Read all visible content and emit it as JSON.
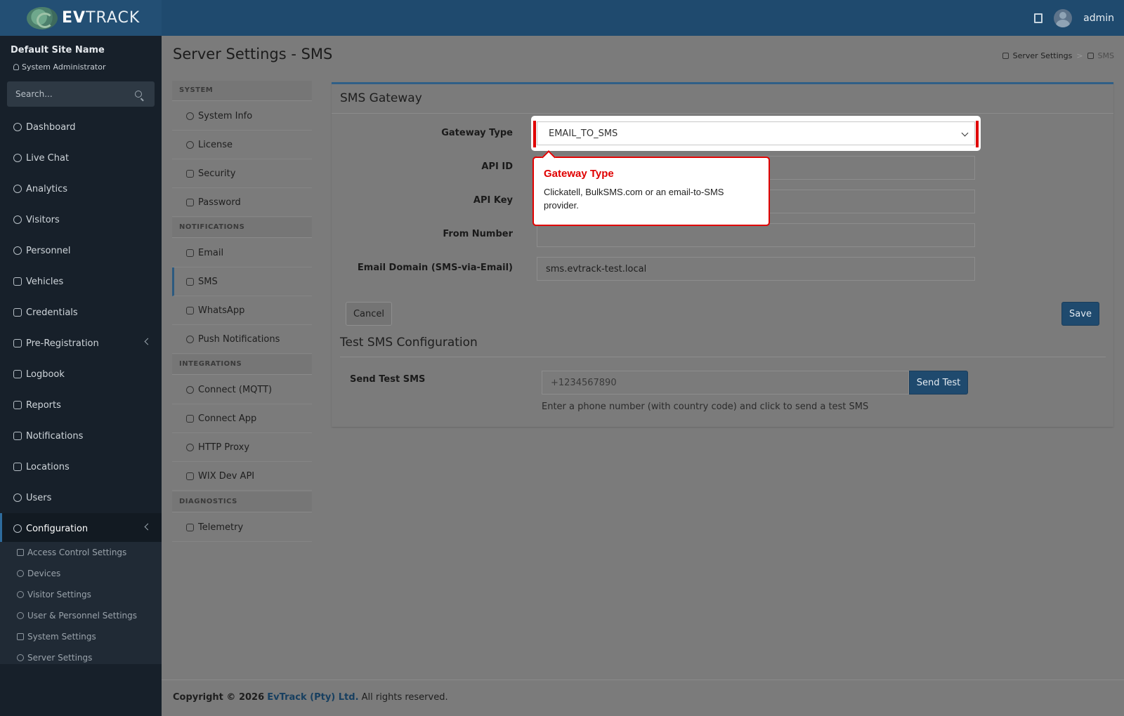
{
  "header": {
    "logo_text_bold": "EV",
    "logo_text": "TRACK",
    "user_name": "admin",
    "icons": [
      "book-icon",
      "avatar"
    ]
  },
  "sidebar": {
    "site_name": "Default Site Name",
    "site_role": "System Administrator",
    "search_placeholder": "Search...",
    "items": [
      {
        "label": "Dashboard",
        "icon": "gauge-icon"
      },
      {
        "label": "Live Chat",
        "icon": "headset-icon"
      },
      {
        "label": "Analytics",
        "icon": "target-icon"
      },
      {
        "label": "Visitors",
        "icon": "eye-icon"
      },
      {
        "label": "Personnel",
        "icon": "users-icon"
      },
      {
        "label": "Vehicles",
        "icon": "car-icon"
      },
      {
        "label": "Credentials",
        "icon": "badge-icon"
      },
      {
        "label": "Pre-Registration",
        "icon": "arrows-icon"
      },
      {
        "label": "Logbook",
        "icon": "book-icon"
      },
      {
        "label": "Reports",
        "icon": "chart-icon"
      },
      {
        "label": "Notifications",
        "icon": "chat-icon"
      },
      {
        "label": "Locations",
        "icon": "building-icon"
      },
      {
        "label": "Users",
        "icon": "user-gear-icon"
      },
      {
        "label": "Configuration",
        "icon": "gear-icon"
      }
    ],
    "sub_items": [
      {
        "label": "Access Control Settings",
        "icon": "lock-icon"
      },
      {
        "label": "Devices",
        "icon": "cpu-icon"
      },
      {
        "label": "Visitor Settings",
        "icon": "eye-icon"
      },
      {
        "label": "User & Personnel Settings",
        "icon": "user-gear-icon"
      },
      {
        "label": "System Settings",
        "icon": "sliders-icon"
      },
      {
        "label": "Server Settings",
        "icon": "wrench-icon"
      }
    ]
  },
  "page": {
    "title": "Server Settings - SMS",
    "breadcrumb": [
      "Server Settings",
      "SMS"
    ]
  },
  "settings_nav": {
    "groups": [
      {
        "title": "SYSTEM",
        "items": [
          "System Info",
          "License",
          "Security",
          "Password"
        ]
      },
      {
        "title": "NOTIFICATIONS",
        "items": [
          "Email",
          "SMS",
          "WhatsApp",
          "Push Notifications"
        ]
      },
      {
        "title": "INTEGRATIONS",
        "items": [
          "Connect (MQTT)",
          "Connect App",
          "HTTP Proxy",
          "WIX Dev API"
        ]
      },
      {
        "title": "DIAGNOSTICS",
        "items": [
          "Telemetry"
        ]
      }
    ],
    "active": "SMS"
  },
  "sms_gateway": {
    "title": "SMS Gateway",
    "fields": {
      "gateway_type": {
        "label": "Gateway Type",
        "value": "EMAIL_TO_SMS"
      },
      "api_id": {
        "label": "API ID",
        "value": ""
      },
      "api_key": {
        "label": "API Key",
        "value": ""
      },
      "from_number": {
        "label": "From Number",
        "value": ""
      },
      "email_domain": {
        "label": "Email Domain (SMS-via-Email)",
        "value": "sms.evtrack-test.local"
      }
    },
    "tooltip": {
      "title": "Gateway Type",
      "body": "Clickatell, BulkSMS.com or an email-to-SMS provider."
    },
    "cancel_label": "Cancel",
    "save_label": "Save"
  },
  "test_sms": {
    "title": "Test SMS Configuration",
    "label": "Send Test SMS",
    "placeholder": "+1234567890",
    "button_label": "Send Test",
    "help": "Enter a phone number (with country code) and click to send a test SMS"
  },
  "footer": {
    "prefix": "Copyright © 2026",
    "company": "EvTrack (Pty) Ltd.",
    "suffix": "All rights reserved."
  }
}
